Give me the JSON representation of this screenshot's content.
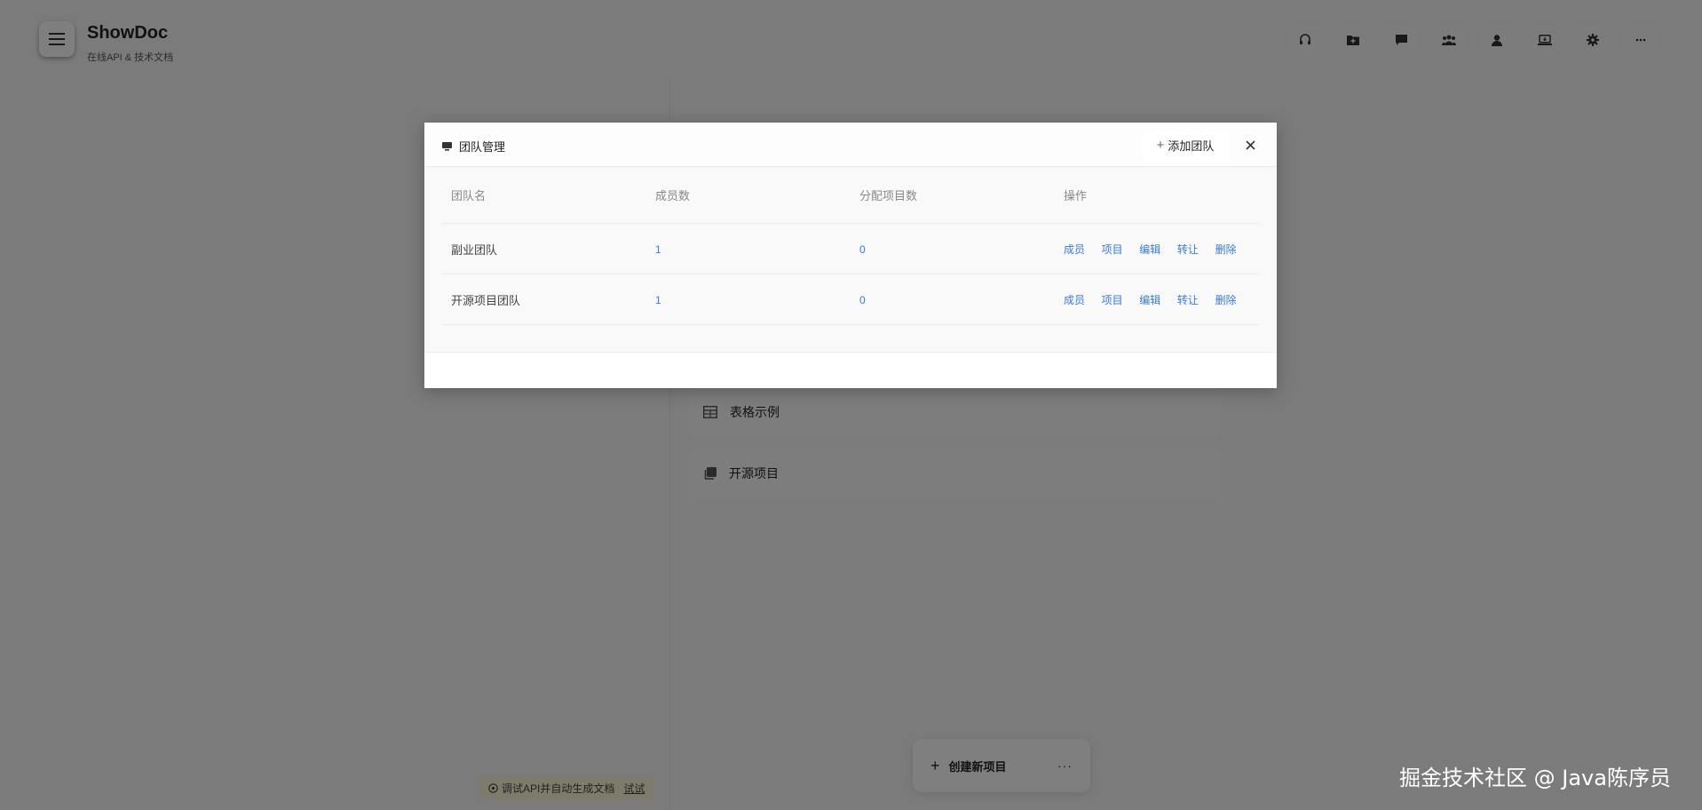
{
  "app": {
    "name": "ShowDoc",
    "subtitle": "在线API & 技术文档"
  },
  "toolbar_icons": [
    "headset-icon",
    "folder-plus-icon",
    "message-icon",
    "users-icon",
    "user-icon",
    "laptop-icon",
    "gear-icon",
    "more-icon"
  ],
  "projects": [
    {
      "label": "表格示例",
      "icon": "table-icon"
    },
    {
      "label": "开源项目",
      "icon": "copy-icon"
    }
  ],
  "bottom": {
    "create_label": "创建新项目",
    "more_label": "···"
  },
  "api_tip": {
    "text": "调试API并自动生成文档",
    "link": "试试"
  },
  "watermark": "掘金技术社区 @ Java陈序员",
  "dialog": {
    "title": "团队管理",
    "add_button": "添加团队",
    "columns": [
      "团队名",
      "成员数",
      "分配项目数",
      "操作"
    ],
    "rows": [
      {
        "name": "副业团队",
        "members": "1",
        "projects": "0",
        "actions": [
          "成员",
          "项目",
          "编辑",
          "转让",
          "删除"
        ]
      },
      {
        "name": "开源项目团队",
        "members": "1",
        "projects": "0",
        "actions": [
          "成员",
          "项目",
          "编辑",
          "转让",
          "删除"
        ]
      }
    ]
  },
  "colors": {
    "link": "#3a7bd5",
    "overlay": "rgba(0,0,0,0.5)"
  }
}
